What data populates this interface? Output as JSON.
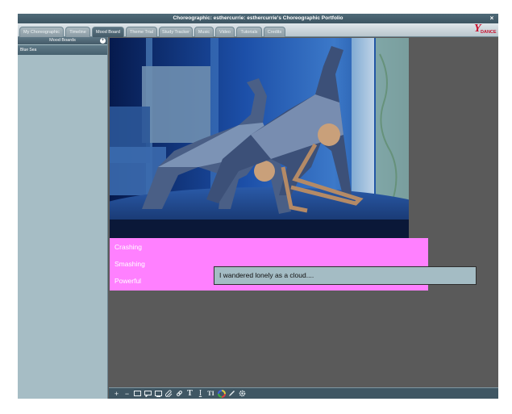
{
  "window": {
    "title": "Choreographic: esthercurrie: esthercurrie's Choreographic Portfolio",
    "close_glyph": "×"
  },
  "tabs": [
    {
      "label": "My Choreographic",
      "active": false
    },
    {
      "label": "Timeline",
      "active": false
    },
    {
      "label": "Mood Board",
      "active": true
    },
    {
      "label": "Theme Trial",
      "active": false
    },
    {
      "label": "Study Tracker",
      "active": false
    },
    {
      "label": "Music",
      "active": false
    },
    {
      "label": "Video",
      "active": false
    },
    {
      "label": "Tutorials",
      "active": false
    },
    {
      "label": "Credits",
      "active": false
    }
  ],
  "logo": {
    "mark": "Y",
    "text": "DANCE",
    "color": "#c8102e"
  },
  "sidebar": {
    "header": "Mood Boards",
    "add_glyph": "+",
    "items": [
      {
        "label": "Blue Sea"
      }
    ]
  },
  "board": {
    "words": [
      "Crashing",
      "Smashing",
      "Powerful"
    ],
    "word_color": "#ffffff",
    "pink_color": "#ff80ff",
    "poem_text": "I wandered lonely as a cloud...."
  },
  "toolbar": {
    "tools": [
      {
        "name": "add-icon"
      },
      {
        "name": "remove-icon"
      },
      {
        "name": "rectangle-icon"
      },
      {
        "name": "callout-icon"
      },
      {
        "name": "frame-icon"
      },
      {
        "name": "attach-icon"
      },
      {
        "name": "link-icon"
      },
      {
        "name": "text-large-icon"
      },
      {
        "name": "text-medium-icon"
      },
      {
        "name": "text-size-icon"
      },
      {
        "name": "color-wheel-icon"
      },
      {
        "name": "pen-icon"
      },
      {
        "name": "settings-icon"
      }
    ]
  }
}
